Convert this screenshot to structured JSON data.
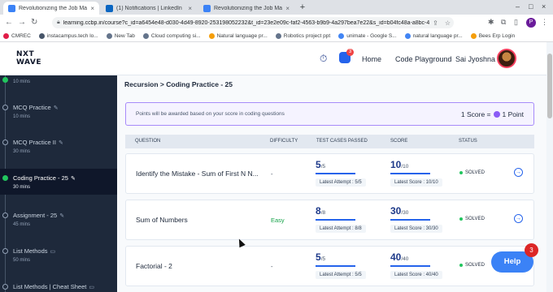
{
  "browser": {
    "tabs": [
      {
        "label": "Revolutionizing the Job Market",
        "favicon_color": "#3b82f6",
        "active": true
      },
      {
        "label": "(1) Notifications | LinkedIn",
        "favicon_color": "#0a66c2",
        "active": false
      },
      {
        "label": "Revolutionizing the Job Market",
        "favicon_color": "#3b82f6",
        "active": false
      }
    ],
    "new_tab": "+",
    "url": "learning.ccbp.in/course?c_id=a6454e48-d030-4d49-8920-253198052232&t_id=23e2e09c-faf2-4563-b9b9-4a297bea7e22&s_id=b04fc48a-a8bc-4adc-ae...",
    "profile_initial": "P",
    "bookmarks": [
      {
        "label": "CMREC",
        "color": "#e11d48"
      },
      {
        "label": "instacampus.tech lo...",
        "color": "#475569"
      },
      {
        "label": "New Tab",
        "color": "#64748b"
      },
      {
        "label": "Cloud computing si...",
        "color": "#64748b"
      },
      {
        "label": "Natural language pr...",
        "color": "#f59e0b"
      },
      {
        "label": "Robotics project ppt",
        "color": "#64748b"
      },
      {
        "label": "unimate - Google S...",
        "color": "#4285f4"
      },
      {
        "label": "natural language pr...",
        "color": "#4285f4"
      },
      {
        "label": "Bees Erp Login",
        "color": "#f59e0b"
      }
    ]
  },
  "header": {
    "logo_line1": "NXT",
    "logo_line2": "WAVE",
    "chat_badge": "3",
    "nav": [
      "Home",
      "Code Playground"
    ],
    "user_name": "Sai Jyoshna"
  },
  "sidebar": {
    "items": [
      {
        "name": "",
        "duration": "10 mins",
        "done": true
      },
      {
        "name": "MCQ Practice",
        "duration": "10 mins",
        "done": false
      },
      {
        "name": "MCQ Practice II",
        "duration": "30 mins",
        "done": false
      },
      {
        "name": "Coding Practice - 25",
        "duration": "30 mins",
        "done": true,
        "active": true
      },
      {
        "name": "Assignment - 25",
        "duration": "45 mins",
        "done": false
      },
      {
        "name": "List Methods",
        "duration": "50 mins",
        "done": false
      },
      {
        "name": "List Methods | Cheat Sheet",
        "duration": "",
        "done": false
      }
    ]
  },
  "main": {
    "breadcrumb": "Recursion > Coding Practice - 25",
    "points_message": "Points will be awarded based on your score in coding questions",
    "score_left": "1 Score =",
    "score_right": "1 Point",
    "columns": [
      "QUESTION",
      "DIFFICULTY",
      "TEST CASES PASSED",
      "SCORE",
      "STATUS"
    ],
    "rows": [
      {
        "question": "Identify the Mistake - Sum of First N N...",
        "difficulty": "-",
        "easy": false,
        "tests_passed": "5",
        "tests_total": "/5",
        "tests_fraction": 1.0,
        "latest_attempt": "Latest Attempt : 5/5",
        "score": "10",
        "score_total": "/10",
        "score_fraction": 1.0,
        "latest_score": "Latest Score : 10/10",
        "status": "SOLVED"
      },
      {
        "question": "Sum of Numbers",
        "difficulty": "Easy",
        "easy": true,
        "tests_passed": "8",
        "tests_total": "/8",
        "tests_fraction": 1.0,
        "latest_attempt": "Latest Attempt : 8/8",
        "score": "30",
        "score_total": "/30",
        "score_fraction": 1.0,
        "latest_score": "Latest Score : 30/30",
        "status": "SOLVED"
      },
      {
        "question": "Factorial - 2",
        "difficulty": "-",
        "easy": false,
        "tests_passed": "5",
        "tests_total": "/5",
        "tests_fraction": 1.0,
        "latest_attempt": "Latest Attempt : 5/5",
        "score": "40",
        "score_total": "/40",
        "score_fraction": 1.0,
        "latest_score": "Latest Score : 40/40",
        "status": "SOLVED"
      }
    ]
  },
  "help": {
    "label": "Help",
    "badge": "3"
  }
}
